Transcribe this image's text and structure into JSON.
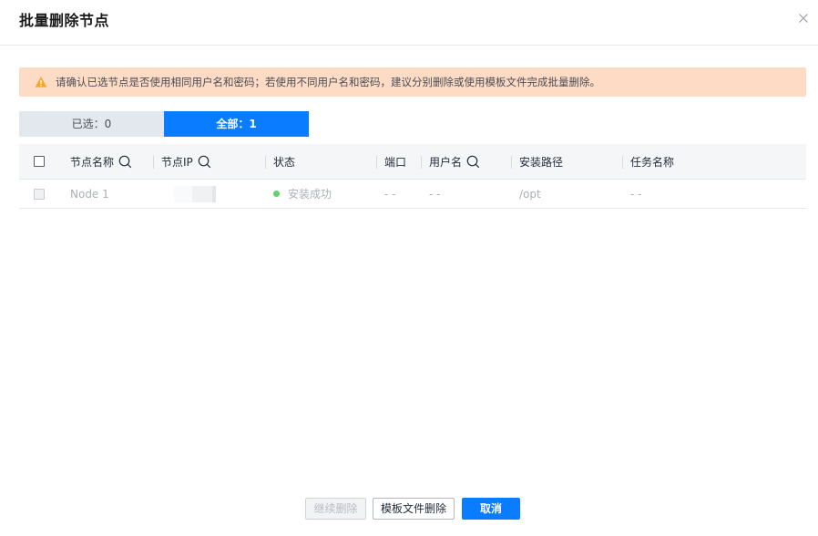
{
  "dialog": {
    "title": "批量删除节点",
    "close_icon": "close-icon"
  },
  "alert": {
    "icon": "warning-icon",
    "icon_color": "#f5a623",
    "background": "#fddbc5",
    "text": "请确认已选节点是否使用相同用户名和密码；若使用不同用户名和密码，建议分别删除或使用模板文件完成批量删除。"
  },
  "tabs": {
    "selected_label": "已选：0",
    "all_label": "全部：1",
    "active": "all",
    "active_color": "#0a7cff"
  },
  "table": {
    "columns": {
      "name": "节点名称",
      "ip": "节点IP",
      "status": "状态",
      "port": "端口",
      "username": "用户名",
      "path": "安装路径",
      "task": "任务名称"
    },
    "rows": [
      {
        "name": "Node 1",
        "ip": "",
        "status": "安装成功",
        "status_color": "#5fd26a",
        "port": "- -",
        "username": "- -",
        "path": "/opt",
        "task": "- -"
      }
    ]
  },
  "footer": {
    "continue_label": "继续删除",
    "template_label": "模板文件删除",
    "cancel_label": "取消"
  }
}
